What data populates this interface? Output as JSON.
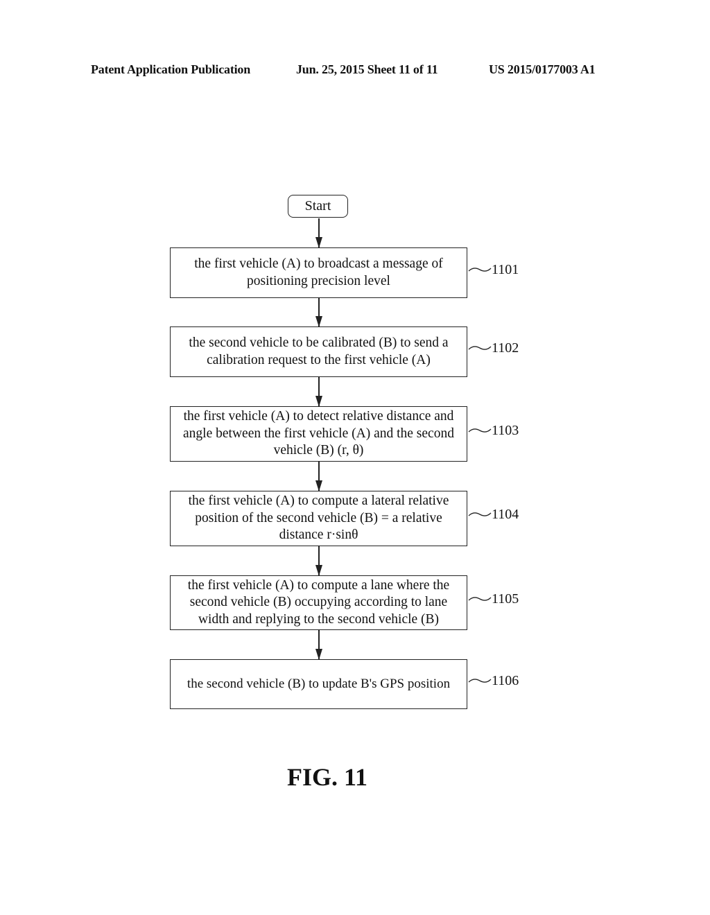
{
  "header": {
    "publication": "Patent Application Publication",
    "date_sheet": "Jun. 25, 2015  Sheet 11 of 11",
    "number": "US 2015/0177003 A1"
  },
  "flowchart": {
    "start_label": "Start",
    "steps": [
      {
        "ref": "1101",
        "text": "the first vehicle  (A) to broadcast a message of positioning precision level"
      },
      {
        "ref": "1102",
        "text": "the second vehicle to be calibrated (B) to send a calibration request to the first vehicle (A)"
      },
      {
        "ref": "1103",
        "text": "the first vehicle (A) to detect relative distance and angle between the first vehicle (A) and the second vehicle (B) (r, θ)"
      },
      {
        "ref": "1104",
        "text": "the first vehicle (A) to compute a lateral relative position of the second vehicle (B) = a relative distance r·sinθ"
      },
      {
        "ref": "1105",
        "text": "the first vehicle (A) to compute a lane where the second vehicle (B) occupying according to lane width and replying to the second vehicle (B)"
      },
      {
        "ref": "1106",
        "text": "the second vehicle (B) to update B's GPS position"
      }
    ]
  },
  "figure_label": "FIG. 11"
}
